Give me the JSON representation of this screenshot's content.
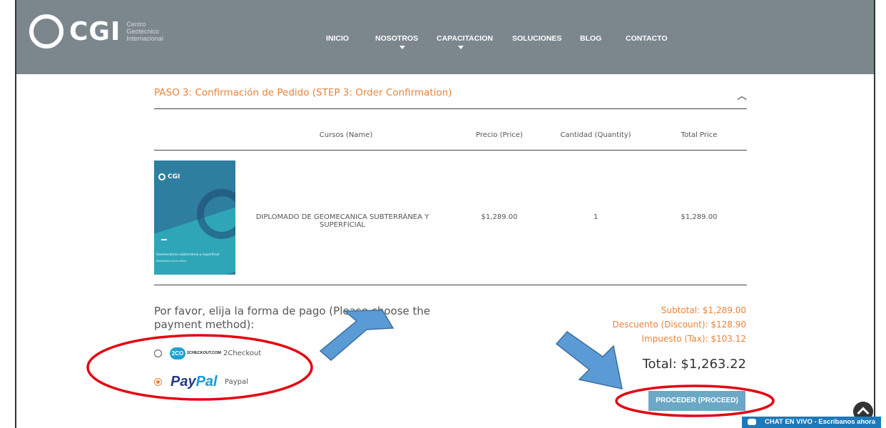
{
  "brand": {
    "name": "CGI",
    "subtitle": [
      "Centro",
      "Geotécnico",
      "Internacional"
    ]
  },
  "nav": [
    "INICIO",
    "NOSOTROS",
    "CAPACITACION",
    "SOLUCIONES",
    "BLOG",
    "CONTACTO"
  ],
  "step": {
    "title": "PASO 3: Confirmación de Pedido (STEP 3: Order Confirmation)"
  },
  "table": {
    "headers": [
      "Cursos (Name)",
      "Precio (Price)",
      "Cantidad (Quantity)",
      "Total Price"
    ],
    "row": {
      "name": "DIPLOMADO DE GEOMECANICA SUBTERRÁNEA Y SUPERFICIAL",
      "price": "$1,289.00",
      "quantity": "1",
      "total": "$1,289.00",
      "thumb_brand": "CGI",
      "thumb_caption": "Geomecánica subterránea y superficial",
      "thumb_subcaption": "Modalidad virtual offline"
    }
  },
  "payment": {
    "prompt": "Por favor, elija la forma de pago (Please choose the payment method):",
    "options": [
      {
        "badge": "2CO",
        "logo_text": "2CHECKOUT.COM",
        "label": "2Checkout",
        "selected": false
      },
      {
        "logo_a": "Pay",
        "logo_b": "Pal",
        "label": "Paypal",
        "selected": true
      }
    ]
  },
  "totals": {
    "subtotal": "Subtotal: $1,289.00",
    "discount": "Descuento (Discount): $128.90",
    "tax": "Impuesto (Tax): $103.12",
    "total": "Total: $1,263.22",
    "proceed": "PROCEDER (PROCEED)"
  },
  "chat": {
    "label": "CHAT EN VIVO - Escríbanos ahora"
  },
  "colors": {
    "header_bg": "#7c868d",
    "accent": "#e88339",
    "button": "#6aa8c6",
    "annotation_red": "#e30613",
    "annotation_arrow": "#5b9bd5",
    "chat_bg": "#1d79b9"
  }
}
